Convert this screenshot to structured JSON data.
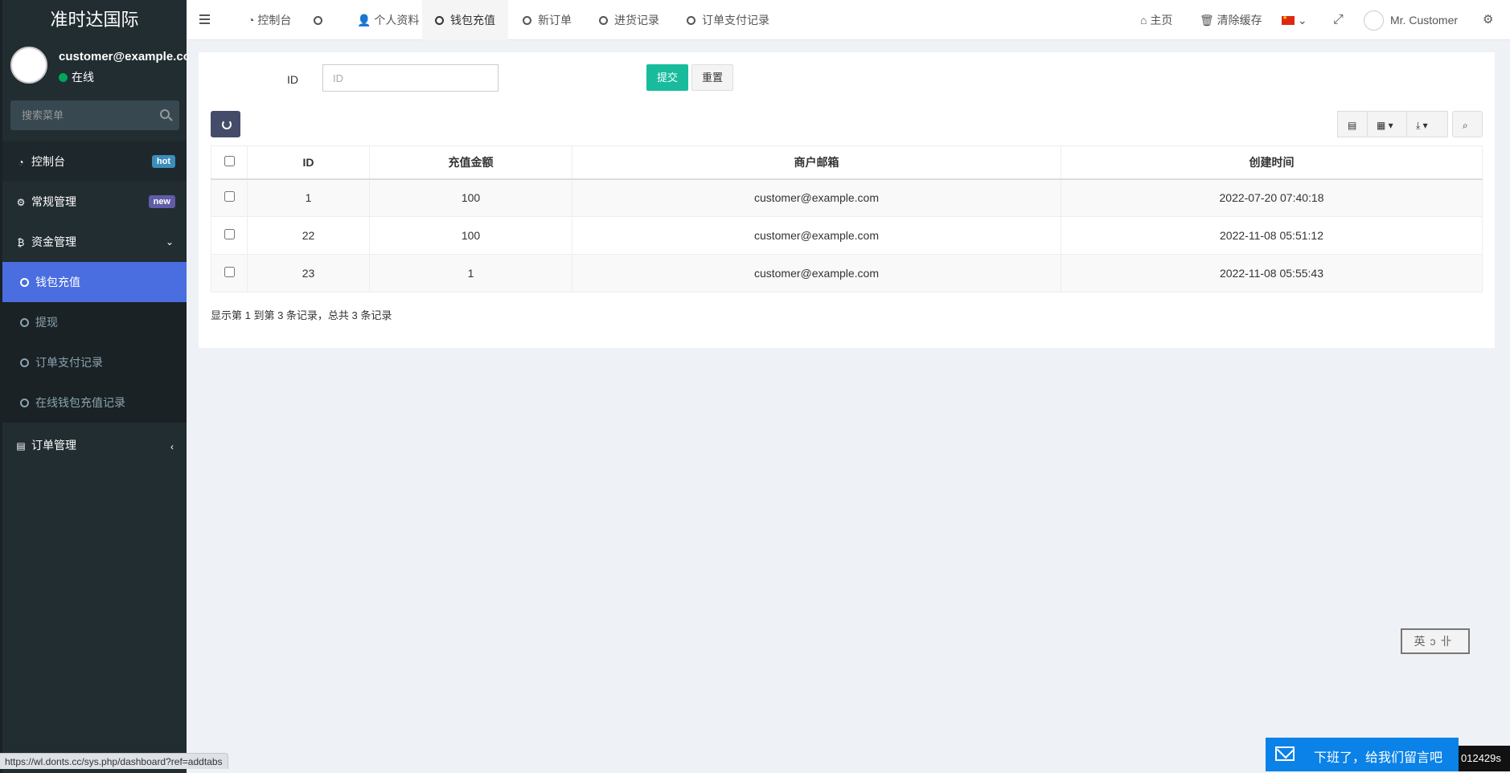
{
  "sidebar": {
    "logo": "准时达国际",
    "user_email": "customer@example.com",
    "user_status": "在线",
    "search_placeholder": "搜索菜单",
    "items": [
      {
        "label": "控制台",
        "badge": "hot"
      },
      {
        "label": "常规管理",
        "badge": "new"
      },
      {
        "label": "资金管理"
      },
      {
        "label": "订单管理"
      }
    ],
    "subitems": [
      "钱包充值",
      "提现",
      "订单支付记录",
      "在线钱包充值记录"
    ]
  },
  "navbar": {
    "tabs": [
      "控制台",
      "",
      "个人资料",
      "钱包充值",
      "新订单",
      "进货记录",
      "订单支付记录"
    ],
    "home": "主页",
    "clear_cache": "清除缓存",
    "user_name": "Mr. Customer"
  },
  "form": {
    "id_label": "ID",
    "id_placeholder": "ID",
    "submit": "提交",
    "reset": "重置"
  },
  "table": {
    "headers": [
      "ID",
      "充值金额",
      "商户邮箱",
      "创建时间"
    ],
    "rows": [
      {
        "id": "1",
        "amount": "100",
        "email": "customer@example.com",
        "created": "2022-07-20 07:40:18"
      },
      {
        "id": "22",
        "amount": "100",
        "email": "customer@example.com",
        "created": "2022-11-08 05:51:12"
      },
      {
        "id": "23",
        "amount": "1",
        "email": "customer@example.com",
        "created": "2022-11-08 05:55:43"
      }
    ],
    "pagination_info": "显示第 1 到第 3 条记录，总共 3 条记录"
  },
  "footer": {
    "status_url": "https://wl.donts.cc/sys.php/dashboard?ref=addtabs",
    "feedback": "下班了，给我们留言吧",
    "timer": "012429s",
    "ime": "英ↄ卝"
  },
  "colors": {
    "sidebar_bg": "#222d32",
    "active_item": "#4a6ee0",
    "submit": "#18bc9c",
    "feedback": "#0a82e8"
  }
}
